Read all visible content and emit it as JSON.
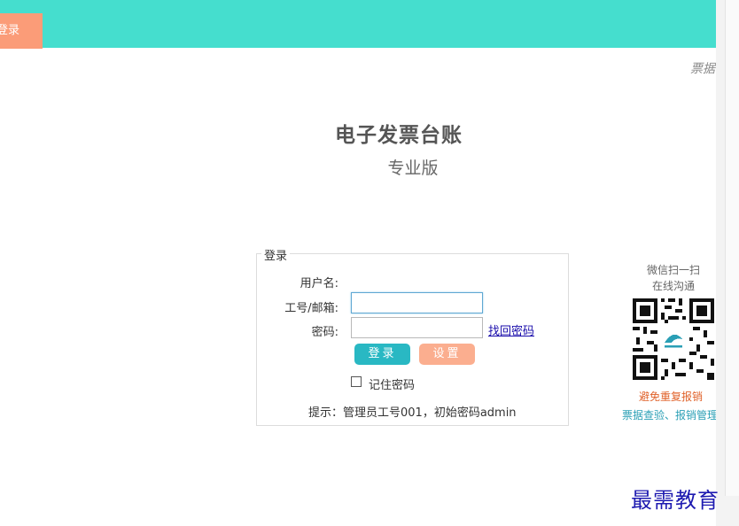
{
  "header": {
    "login_button": "登录",
    "bar_color": "#45dece",
    "button_color": "#fb9c78"
  },
  "top_right_text": "票据",
  "app": {
    "title": "电子发票台账",
    "subtitle": "专业版"
  },
  "login_form": {
    "legend": "登录",
    "username_label": "用户名:",
    "account_label": "工号/邮箱:",
    "account_value": "",
    "password_label": "密码:",
    "password_value": "",
    "forgot_link": "找回密码",
    "login_button": "登录",
    "settings_button": "设置",
    "remember_label": "记住密码",
    "remember_checked": false,
    "hint": "提示：管理员工号001，初始密码admin"
  },
  "wechat": {
    "line1": "微信扫一扫",
    "line2": "在线沟通",
    "qr_icon": "qr-code-icon",
    "promo1": "避免重复报销",
    "promo2": "票据查验、报销管理"
  },
  "watermark": "最需教育",
  "colors": {
    "accent": "#29b8c3",
    "secondary": "#fbae8f",
    "promo_orange": "#e0622a",
    "promo_teal": "#2a9fb5"
  }
}
